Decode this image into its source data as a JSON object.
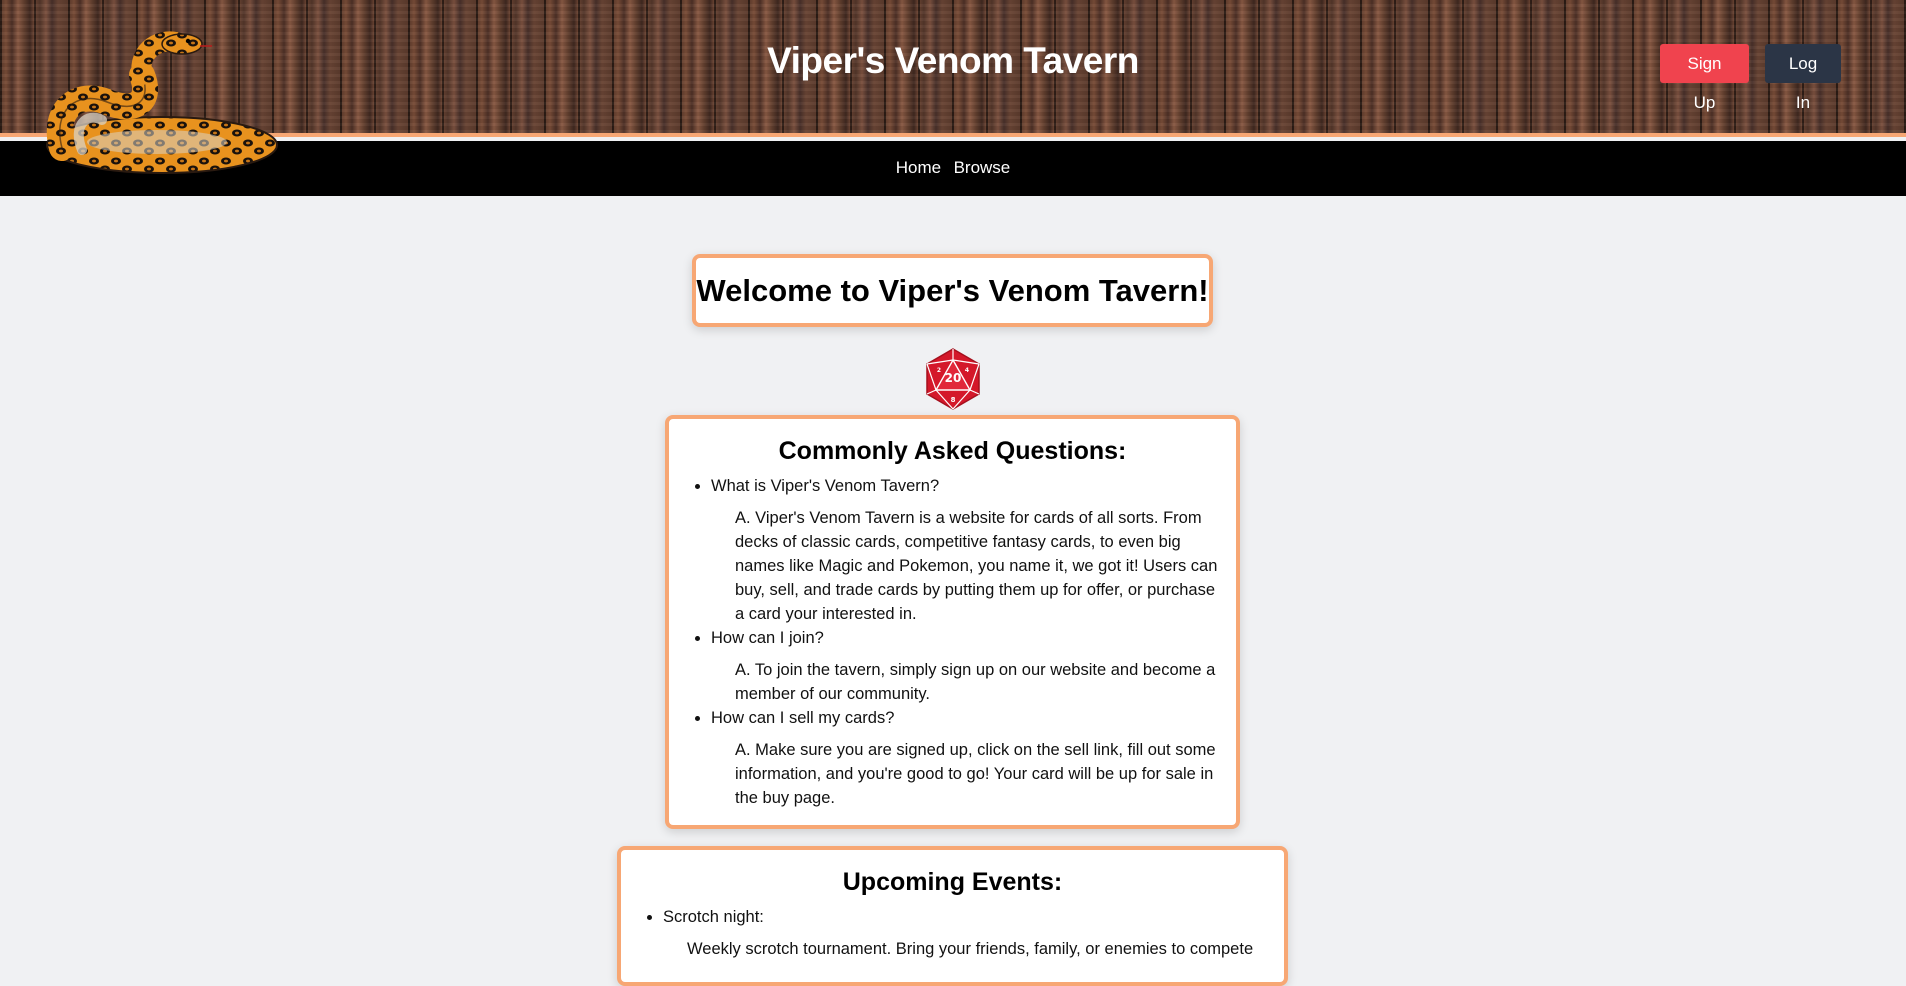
{
  "header": {
    "site_title": "Viper's Venom Tavern",
    "signup_label": "Sign Up",
    "login_label": "Log In",
    "signup_color": "#f0434e",
    "login_color": "#2b3546",
    "accent_color": "#f7a774"
  },
  "nav": {
    "items": [
      {
        "label": "Home"
      },
      {
        "label": "Browse"
      }
    ]
  },
  "main": {
    "welcome_title": "Welcome to Viper's Venom Tavern!",
    "dice_icon": "d20-icon",
    "faq": {
      "title": "Commonly Asked Questions:",
      "items": [
        {
          "question": "What is Viper's Venom Tavern?",
          "answer": "A. Viper's Venom Tavern is a website for cards of all sorts. From decks of classic cards, competitive fantasy cards, to even big names like Magic and Pokemon, you name it, we got it! Users can buy, sell, and trade cards by putting them up for offer, or purchase a card your interested in."
        },
        {
          "question": "How can I join?",
          "answer": "A. To join the tavern, simply sign up on our website and become a member of our community."
        },
        {
          "question": "How can I sell my cards?",
          "answer": "A. Make sure you are signed up, click on the sell link, fill out some information, and you're good to go! Your card will be up for sale in the buy page."
        }
      ]
    },
    "events": {
      "title": "Upcoming Events:",
      "items": [
        {
          "name": "Scrotch night:",
          "description": "Weekly scrotch tournament. Bring your friends, family, or enemies to compete"
        }
      ]
    }
  }
}
